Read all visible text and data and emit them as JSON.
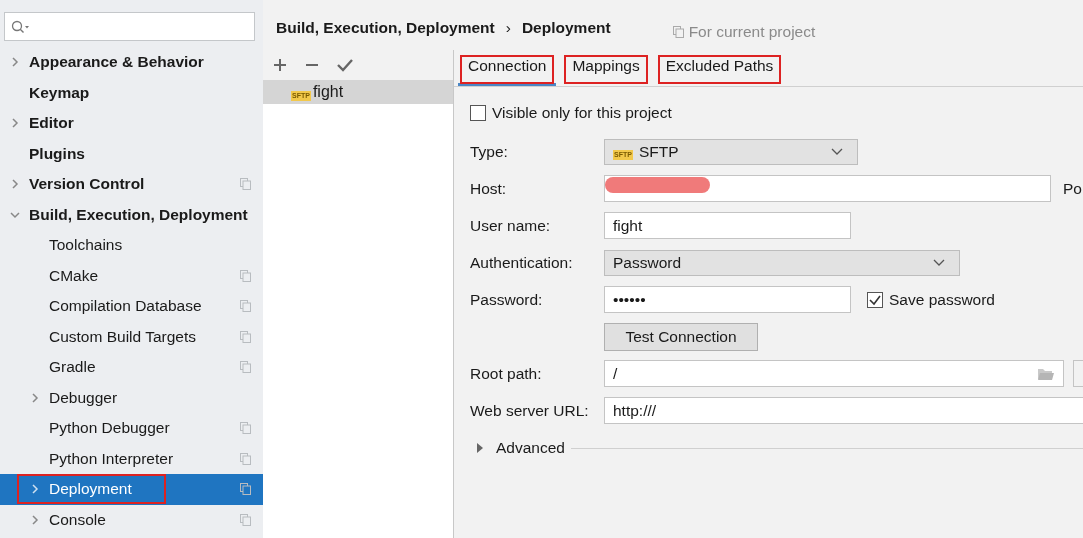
{
  "sidebar": {
    "items": [
      {
        "label": "Appearance & Behavior",
        "expanded": false,
        "project_level": false,
        "selected": false,
        "annotated": false
      },
      {
        "label": "Keymap",
        "project_level": false,
        "selected": false,
        "annotated": false
      },
      {
        "label": "Editor",
        "expanded": false,
        "project_level": false,
        "selected": false,
        "annotated": false
      },
      {
        "label": "Plugins",
        "project_level": false,
        "selected": false,
        "annotated": false
      },
      {
        "label": "Version Control",
        "expanded": false,
        "project_level": true,
        "selected": false,
        "annotated": false
      },
      {
        "label": "Build, Execution, Deployment",
        "expanded": true,
        "project_level": false,
        "selected": false,
        "annotated": false,
        "children": [
          {
            "label": "Toolchains",
            "project_level": false,
            "selected": false,
            "annotated": false
          },
          {
            "label": "CMake",
            "project_level": true,
            "selected": false,
            "annotated": false
          },
          {
            "label": "Compilation Database",
            "project_level": true,
            "selected": false,
            "annotated": false
          },
          {
            "label": "Custom Build Targets",
            "project_level": true,
            "selected": false,
            "annotated": false
          },
          {
            "label": "Gradle",
            "project_level": true,
            "selected": false,
            "annotated": false
          },
          {
            "label": "Debugger",
            "expanded": false,
            "project_level": false,
            "selected": false,
            "annotated": false
          },
          {
            "label": "Python Debugger",
            "project_level": true,
            "selected": false,
            "annotated": false
          },
          {
            "label": "Python Interpreter",
            "project_level": true,
            "selected": false,
            "annotated": false
          },
          {
            "label": "Deployment",
            "expanded": false,
            "project_level": true,
            "selected": true,
            "annotated": true
          },
          {
            "label": "Console",
            "expanded": false,
            "project_level": true,
            "selected": false,
            "annotated": false
          }
        ]
      }
    ]
  },
  "breadcrumb": [
    "Build, Execution, Deployment",
    "›",
    "Deployment"
  ],
  "scope_note": "For current project",
  "servers": [
    {
      "label": "fight",
      "badge": "SFTP",
      "selected": true
    }
  ],
  "tabs": [
    {
      "label": "Connection",
      "selected": true,
      "annotated": true
    },
    {
      "label": "Mappings",
      "selected": false,
      "annotated": true
    },
    {
      "label": "Excluded Paths",
      "selected": false,
      "annotated": true
    }
  ],
  "visible_only": {
    "label": "Visible only for this project",
    "checked": false
  },
  "form": [
    {
      "label": "Type:",
      "kind": "select",
      "value": "SFTP",
      "badge": "SFTP"
    },
    {
      "label": "Host:",
      "kind": "host",
      "redacted": true,
      "side_label": "Po"
    },
    {
      "label": "User name:",
      "kind": "text",
      "value": "fight"
    },
    {
      "label": "Authentication:",
      "kind": "select",
      "value": "Password"
    },
    {
      "label": "Password:",
      "kind": "password",
      "value": "••••••",
      "check": {
        "label": "Save password",
        "checked": true
      }
    },
    {
      "kind": "button",
      "value": "Test Connection"
    },
    {
      "label": "Root path:",
      "kind": "path",
      "value": "/"
    },
    {
      "label": "Web server URL:",
      "kind": "url",
      "value": "http:///"
    }
  ],
  "advanced": {
    "label": "Advanced",
    "expanded": false
  }
}
